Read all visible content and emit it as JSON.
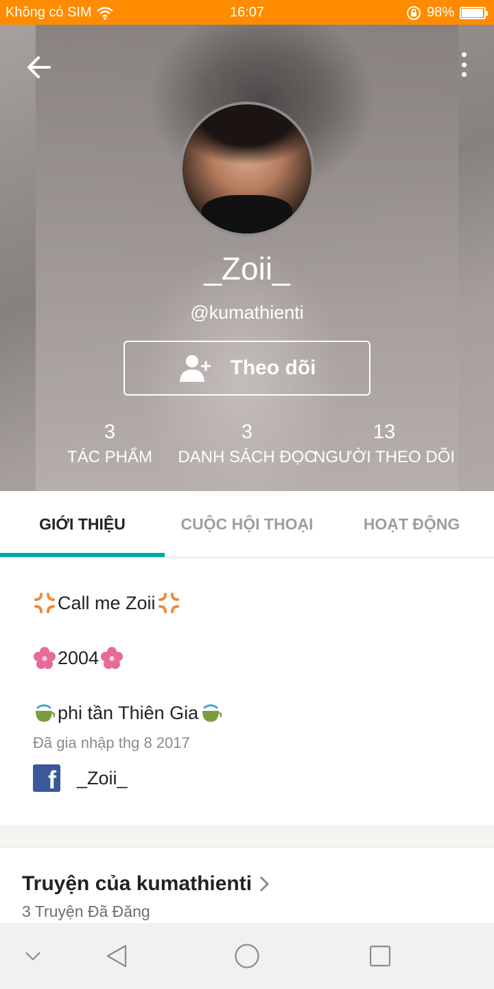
{
  "status_bar": {
    "carrier": "Không có SIM",
    "time": "16:07",
    "battery": "98%",
    "battery_level": 0.98,
    "bg_color": "#ff8c00"
  },
  "header": {
    "back_icon": "arrow-left-icon",
    "menu_icon": "more-vertical-icon",
    "display_name": "_Zoii_",
    "username": "@kumathienti",
    "follow_button_label": "Theo dõi",
    "follow_icon": "add-user-icon"
  },
  "stats": [
    {
      "value": "3",
      "label": "TÁC PHẨM"
    },
    {
      "value": "3",
      "label": "DANH SÁCH ĐỌC"
    },
    {
      "value": "13",
      "label": "NGƯỜI THEO DÕI"
    }
  ],
  "tabs": [
    {
      "label": "GIỚI THIỆU",
      "active": true
    },
    {
      "label": "CUỘC HỘI THOẠI",
      "active": false
    },
    {
      "label": "HOẠT ĐỘNG",
      "active": false
    }
  ],
  "accent_color": "#00a5a5",
  "about": {
    "bio": [
      {
        "text": "Call me Zoii",
        "icon": "anger-symbol-icon"
      },
      {
        "text": "2004",
        "icon": "cherry-blossom-icon"
      },
      {
        "text": "phi tần Thiên Gia",
        "icon": "teacup-icon"
      }
    ],
    "joined": "Đã gia nhập thg 8 2017",
    "facebook": {
      "icon": "facebook-icon",
      "name": "_Zoii_"
    }
  },
  "stories": {
    "title": "Truyện của kumathienti",
    "subtitle": "3 Truyện Đã Đăng"
  },
  "nav_bar": [
    "chevron-down-icon",
    "back-triangle-icon",
    "home-circle-icon",
    "recents-square-icon"
  ]
}
